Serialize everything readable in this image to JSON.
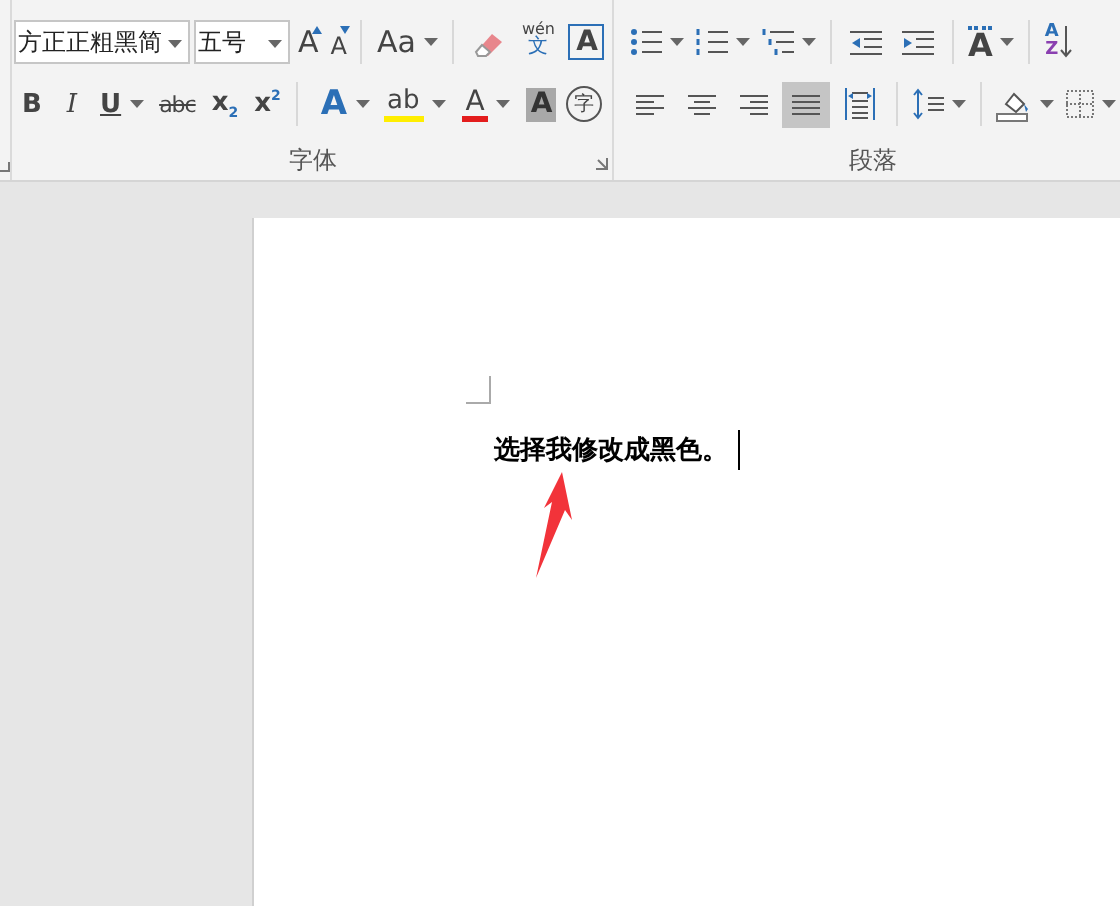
{
  "ribbon": {
    "font_group": {
      "label": "字体",
      "font_name": "方正正粗黑简",
      "font_size": "五号",
      "grow_font": "A",
      "shrink_font": "A",
      "change_case": "Aa",
      "phonetic_guide": {
        "pinyin": "wén",
        "character": "文"
      },
      "character_border": "A",
      "bold": "B",
      "italic": "I",
      "underline": "U",
      "strikethrough": "abc",
      "subscript": "x$_{2}$",
      "superscript": "x$^{2}$",
      "text_effects": "A",
      "highlight": "ab",
      "font_color": "A",
      "character_shading": "A",
      "enclose_characters": "字"
    },
    "paragraph_group": {
      "label": "段落",
      "row_1": [
        {
          "kind": "bullets"
        },
        {
          "kind": "numbering"
        },
        {
          "kind": "multilevel"
        },
        {
          "kind": "sep"
        },
        {
          "kind": "decrease-indent"
        },
        {
          "kind": "increase-indent"
        },
        {
          "kind": "sep"
        },
        {
          "kind": "text-direction",
          "glyph": "A"
        },
        {
          "kind": "sep"
        },
        {
          "kind": "sort",
          "glyph": "A",
          "glyph_2": "Z"
        }
      ],
      "row_2": [
        {
          "kind": "align-left",
          "selected": false
        },
        {
          "kind": "align-center",
          "selected": false
        },
        {
          "kind": "align-right",
          "selected": false
        },
        {
          "kind": "justify",
          "selected": true
        },
        {
          "kind": "distributed",
          "selected": false
        },
        {
          "kind": "sep"
        },
        {
          "kind": "line-spacing"
        },
        {
          "kind": "sep"
        },
        {
          "kind": "shading"
        },
        {
          "kind": "borders"
        }
      ]
    }
  },
  "document": {
    "text": "选择我修改成黑色。"
  }
}
